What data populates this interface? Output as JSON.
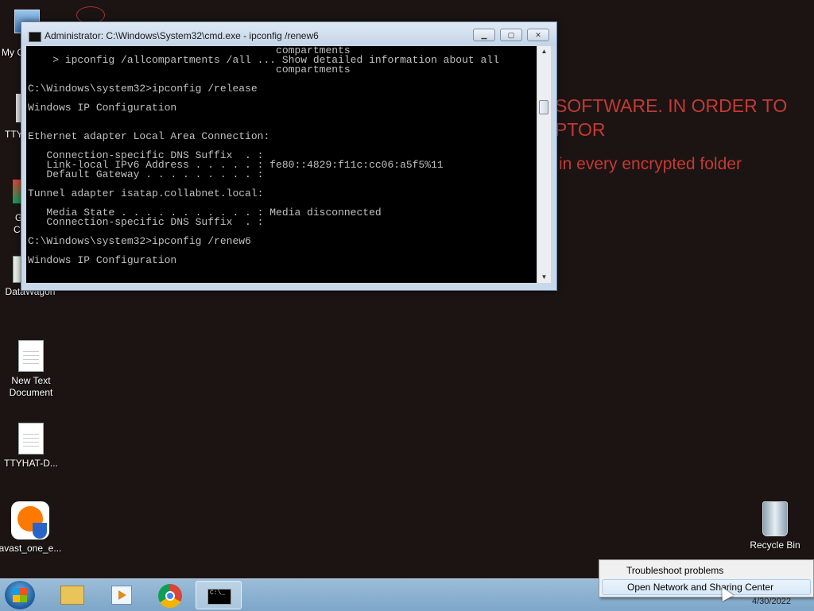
{
  "wallpaper": {
    "line1": "SOFTWARE. IN ORDER TO",
    "line2": "PTOR",
    "line3": "in every encrypted folder"
  },
  "desktop": {
    "partial_labels": [
      "My C",
      "TTY",
      "G",
      "C"
    ],
    "icons": [
      {
        "label": "DataWagon",
        "icon": "datawagon-icon"
      },
      {
        "label": "New Text Document",
        "icon": "text-document-icon"
      },
      {
        "label": "TTYHAT-D...",
        "icon": "text-document-icon"
      },
      {
        "label": "avast_one_e...",
        "icon": "avast-icon"
      },
      {
        "label": "Recycle Bin",
        "icon": "recycle-bin-icon"
      }
    ]
  },
  "cmd_window": {
    "title": "Administrator: C:\\Windows\\System32\\cmd.exe - ipconfig  /renew6",
    "buttons": {
      "minimize": "▁",
      "maximize": "▢",
      "close": "✕"
    },
    "console_text": "                                        compartments\n    > ipconfig /allcompartments /all ... Show detailed information about all\n                                        compartments\n\nC:\\Windows\\system32>ipconfig /release\n\nWindows IP Configuration\n\n\nEthernet adapter Local Area Connection:\n\n   Connection-specific DNS Suffix  . :\n   Link-local IPv6 Address . . . . . : fe80::4829:f11c:cc06:a5f5%11\n   Default Gateway . . . . . . . . . :\n\nTunnel adapter isatap.collabnet.local:\n\n   Media State . . . . . . . . . . . : Media disconnected\n   Connection-specific DNS Suffix  . :\n\nC:\\Windows\\system32>ipconfig /renew6\n\nWindows IP Configuration"
  },
  "taskbar": {
    "items": [
      {
        "name": "start-button"
      },
      {
        "name": "windows-explorer-icon"
      },
      {
        "name": "windows-media-player-icon"
      },
      {
        "name": "chrome-icon"
      },
      {
        "name": "cmd-icon",
        "active": true
      }
    ],
    "cmd_glyph": "C:\\_",
    "date": "4/30/2022"
  },
  "context_menu": {
    "items": [
      "Troubleshoot problems",
      "Open Network and Sharing Center"
    ]
  },
  "colors": {
    "wallpaper": "#1b1413",
    "ransom_text": "#c43a35",
    "console_bg": "#000000",
    "console_text": "#c0c0c0"
  }
}
